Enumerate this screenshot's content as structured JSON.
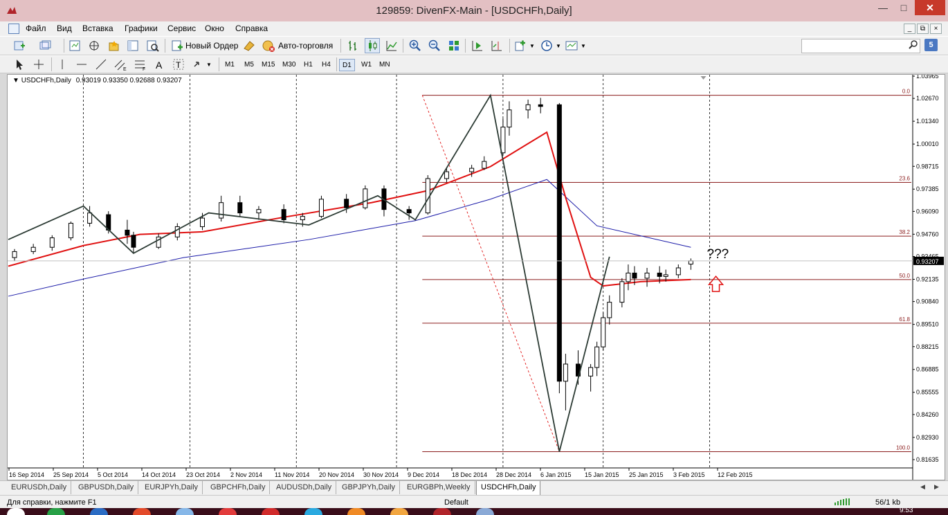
{
  "window": {
    "title": "129859: DivenFX-Main - [USDCHFh,Daily]"
  },
  "menu": [
    "Файл",
    "Вид",
    "Вставка",
    "Графики",
    "Сервис",
    "Окно",
    "Справка"
  ],
  "toolbar": {
    "new_order": "Новый Ордер",
    "auto_trading": "Авто-торговля",
    "search_placeholder": "",
    "notifications": "5"
  },
  "timeframes": [
    "M1",
    "M5",
    "M15",
    "M30",
    "H1",
    "H4",
    "D1",
    "W1",
    "MN"
  ],
  "active_timeframe": "D1",
  "chart": {
    "symbol": "USDCHFh,Daily",
    "ohlc": "0.93019 0.93350 0.92688 0.93207",
    "current_price": "0.93207",
    "annotation": "???",
    "colors": {
      "ma_fast": "#e01010",
      "ma_slow": "#1a1aa8",
      "zigzag": "#2b3a33",
      "fib": "#8b1c1c",
      "price_tag": "#000000"
    }
  },
  "chart_data": {
    "type": "candlestick",
    "x_ticks": [
      "16 Sep 2014",
      "25 Sep 2014",
      "5 Oct 2014",
      "14 Oct 2014",
      "23 Oct 2014",
      "2 Nov 2014",
      "11 Nov 2014",
      "20 Nov 2014",
      "30 Nov 2014",
      "9 Dec 2014",
      "18 Dec 2014",
      "28 Dec 2014",
      "6 Jan 2015",
      "15 Jan 2015",
      "25 Jan 2015",
      "3 Feb 2015",
      "12 Feb 2015"
    ],
    "y_ticks": [
      "1.03965",
      "1.02670",
      "1.01340",
      "1.00010",
      "0.98715",
      "0.97385",
      "0.96090",
      "0.94760",
      "0.93465",
      "0.92135",
      "0.90840",
      "0.89510",
      "0.88215",
      "0.86885",
      "0.85555",
      "0.84260",
      "0.82930",
      "0.81635"
    ],
    "ylim": [
      0.81635,
      1.03965
    ],
    "fibonacci_levels": [
      {
        "label": "0.0",
        "price": 1.0285
      },
      {
        "label": "23.6",
        "price": 0.9778
      },
      {
        "label": "38.2",
        "price": 0.9465
      },
      {
        "label": "50.0",
        "price": 0.9212
      },
      {
        "label": "61.8",
        "price": 0.8958
      },
      {
        "label": "100.0",
        "price": 0.821
      }
    ],
    "zigzag": [
      [
        "15 Sep 2014",
        0.9445
      ],
      [
        "1 Oct 2014",
        0.964
      ],
      [
        "13 Oct 2014",
        0.9365
      ],
      [
        "29 Oct 2014",
        0.96
      ],
      [
        "20 Nov 2014",
        0.953
      ],
      [
        "5 Dec 2014",
        0.97
      ],
      [
        "15 Dec 2014",
        0.956
      ],
      [
        "31 Dec 2014",
        1.0285
      ],
      [
        "15 Jan 2015",
        0.821
      ],
      [
        "27 Jan 2015",
        0.9345
      ]
    ],
    "ma_fast": [
      [
        "15 Sep 2014",
        0.929
      ],
      [
        "1 Oct 2014",
        0.941
      ],
      [
        "14 Oct 2014",
        0.9475
      ],
      [
        "28 Oct 2014",
        0.949
      ],
      [
        "14 Nov 2014",
        0.9575
      ],
      [
        "4 Dec 2014",
        0.966
      ],
      [
        "17 Dec 2014",
        0.973
      ],
      [
        "31 Dec 2014",
        0.987
      ],
      [
        "13 Jan 2015",
        1.007
      ],
      [
        "16 Jan 2015",
        0.969
      ],
      [
        "22 Jan 2015",
        0.9225
      ],
      [
        "26 Jan 2015",
        0.9175
      ],
      [
        "3 Feb 2015",
        0.92
      ],
      [
        "13 Feb 2015",
        0.9212
      ]
    ],
    "ma_slow": [
      [
        "15 Sep 2014",
        0.9115
      ],
      [
        "1 Oct 2014",
        0.9215
      ],
      [
        "23 Oct 2014",
        0.934
      ],
      [
        "20 Nov 2014",
        0.9445
      ],
      [
        "15 Dec 2014",
        0.9555
      ],
      [
        "31 Dec 2014",
        0.968
      ],
      [
        "13 Jan 2015",
        0.9795
      ],
      [
        "24 Jan 2015",
        0.9525
      ],
      [
        "13 Feb 2015",
        0.94
      ]
    ],
    "candles": [
      [
        "16 Sep 2014",
        0.934,
        0.939,
        0.932,
        0.9375
      ],
      [
        "19 Sep 2014",
        0.9375,
        0.942,
        0.936,
        0.94
      ],
      [
        "24 Sep 2014",
        0.94,
        0.947,
        0.938,
        0.9455
      ],
      [
        "29 Sep 2014",
        0.9455,
        0.955,
        0.944,
        0.954
      ],
      [
        "2 Oct 2014",
        0.954,
        0.964,
        0.952,
        0.96
      ],
      [
        "7 Oct 2014",
        0.959,
        0.961,
        0.948,
        0.95
      ],
      [
        "10 Oct 2014",
        0.95,
        0.956,
        0.942,
        0.947
      ],
      [
        "13 Oct 2014",
        0.947,
        0.949,
        0.9365,
        0.94
      ],
      [
        "17 Oct 2014",
        0.94,
        0.948,
        0.939,
        0.946
      ],
      [
        "22 Oct 2014",
        0.946,
        0.954,
        0.944,
        0.952
      ],
      [
        "28 Oct 2014",
        0.952,
        0.96,
        0.95,
        0.957
      ],
      [
        "31 Oct 2014",
        0.957,
        0.97,
        0.955,
        0.966
      ],
      [
        "5 Nov 2014",
        0.966,
        0.97,
        0.958,
        0.96
      ],
      [
        "10 Nov 2014",
        0.96,
        0.964,
        0.956,
        0.962
      ],
      [
        "14 Nov 2014",
        0.962,
        0.965,
        0.954,
        0.956
      ],
      [
        "19 Nov 2014",
        0.956,
        0.96,
        0.952,
        0.958
      ],
      [
        "24 Nov 2014",
        0.958,
        0.97,
        0.957,
        0.968
      ],
      [
        "28 Nov 2014",
        0.968,
        0.971,
        0.96,
        0.963
      ],
      [
        "3 Dec 2014",
        0.963,
        0.976,
        0.962,
        0.974
      ],
      [
        "8 Dec 2014",
        0.974,
        0.976,
        0.958,
        0.962
      ],
      [
        "12 Dec 2014",
        0.962,
        0.964,
        0.956,
        0.96
      ],
      [
        "17 Dec 2014",
        0.96,
        0.982,
        0.959,
        0.98
      ],
      [
        "22 Dec 2014",
        0.98,
        0.986,
        0.978,
        0.984
      ],
      [
        "26 Dec 2014",
        0.984,
        0.988,
        0.981,
        0.986
      ],
      [
        "30 Dec 2014",
        0.986,
        0.993,
        0.985,
        0.99
      ],
      [
        "2 Jan 2015",
        0.995,
        1.015,
        0.994,
        1.01
      ],
      [
        "5 Jan 2015",
        1.01,
        1.025,
        1.005,
        1.02
      ],
      [
        "8 Jan 2015",
        1.02,
        1.026,
        1.015,
        1.023
      ],
      [
        "12 Jan 2015",
        1.023,
        1.027,
        1.018,
        1.022
      ],
      [
        "15 Jan 2015",
        1.023,
        1.024,
        0.855,
        0.862
      ],
      [
        "16 Jan 2015",
        0.862,
        0.878,
        0.845,
        0.872
      ],
      [
        "20 Jan 2015",
        0.872,
        0.88,
        0.86,
        0.865
      ],
      [
        "22 Jan 2015",
        0.865,
        0.872,
        0.856,
        0.87
      ],
      [
        "23 Jan 2015",
        0.87,
        0.885,
        0.865,
        0.882
      ],
      [
        "26 Jan 2015",
        0.882,
        0.902,
        0.88,
        0.899
      ],
      [
        "27 Jan 2015",
        0.899,
        0.912,
        0.895,
        0.908
      ],
      [
        "29 Jan 2015",
        0.908,
        0.922,
        0.905,
        0.92
      ],
      [
        "30 Jan 2015",
        0.92,
        0.93,
        0.915,
        0.925
      ],
      [
        "2 Feb 2015",
        0.925,
        0.929,
        0.918,
        0.922
      ],
      [
        "4 Feb 2015",
        0.922,
        0.928,
        0.917,
        0.925
      ],
      [
        "6 Feb 2015",
        0.925,
        0.929,
        0.919,
        0.923
      ],
      [
        "9 Feb 2015",
        0.923,
        0.927,
        0.92,
        0.924
      ],
      [
        "11 Feb 2015",
        0.924,
        0.93,
        0.922,
        0.928
      ],
      [
        "13 Feb 2015",
        0.9302,
        0.9335,
        0.9269,
        0.9321
      ]
    ]
  },
  "tabs": [
    "EURUSDh,Daily",
    "GBPUSDh,Daily",
    "EURJPYh,Daily",
    "GBPCHFh,Daily",
    "AUDUSDh,Daily",
    "GBPJPYh,Daily",
    "EURGBPh,Weekly",
    "USDCHFh,Daily"
  ],
  "active_tab": "USDCHFh,Daily",
  "status": {
    "help": "Для справки, нажмите F1",
    "profile": "Default",
    "traffic": "56/1 kb"
  },
  "taskbar": {
    "clock": "9:53"
  }
}
